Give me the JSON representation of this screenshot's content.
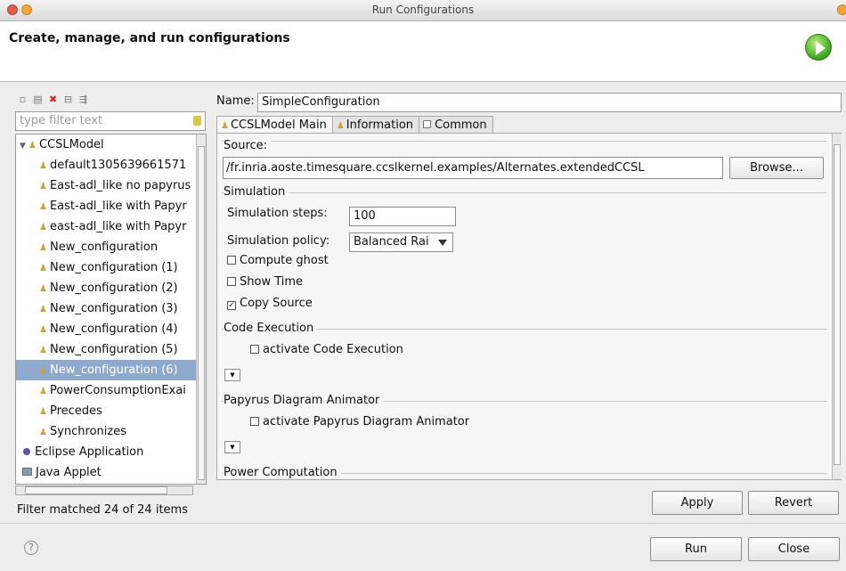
{
  "window": {
    "title": "Run Configurations"
  },
  "header": {
    "title": "Create, manage, and run configurations"
  },
  "left": {
    "filter_placeholder": "type filter text",
    "toolbar_icons": [
      "new-launch-config-icon",
      "duplicate-icon",
      "delete-icon",
      "collapse-all-icon",
      "filter-icon"
    ],
    "tree": {
      "root": "CCSLModel",
      "children": [
        "default1305639661571",
        "East-adl_like no papyrus",
        "East-adl_like with Papyr",
        "east-adl_like with Papyr",
        "New_configuration",
        "New_configuration (1)",
        "New_configuration (2)",
        "New_configuration (3)",
        "New_configuration (4)",
        "New_configuration (5)",
        "New_configuration (6)",
        "PowerConsumptionExai",
        "Precedes",
        "Synchronizes"
      ],
      "selected_index": 10,
      "other_roots": [
        "Eclipse Application",
        "Java Applet"
      ]
    },
    "status": "Filter matched 24 of 24 items"
  },
  "right": {
    "name_label": "Name:",
    "name_value": "SimpleConfiguration",
    "tabs": [
      "CCSLModel Main",
      "Information",
      "Common"
    ],
    "source": {
      "title": "Source:",
      "path": "/fr.inria.aoste.timesquare.ccslkernel.examples/Alternates.extendedCCSL",
      "browse": "Browse..."
    },
    "simulation": {
      "title": "Simulation",
      "steps_label": "Simulation steps:",
      "steps_value": "100",
      "policy_label": "Simulation policy:",
      "policy_value": "Balanced Rai",
      "compute_ghost": "Compute ghost",
      "show_time": "Show Time",
      "copy_source": "Copy Source",
      "copy_source_checked": true
    },
    "code_execution": {
      "title": "Code Execution",
      "activate": "activate Code Execution"
    },
    "papyrus": {
      "title": "Papyrus Diagram Animator",
      "activate": "activate Papyrus Diagram Animator"
    },
    "power": {
      "title": "Power Computation"
    },
    "apply": "Apply",
    "revert": "Revert"
  },
  "footer": {
    "run": "Run",
    "close": "Close"
  }
}
